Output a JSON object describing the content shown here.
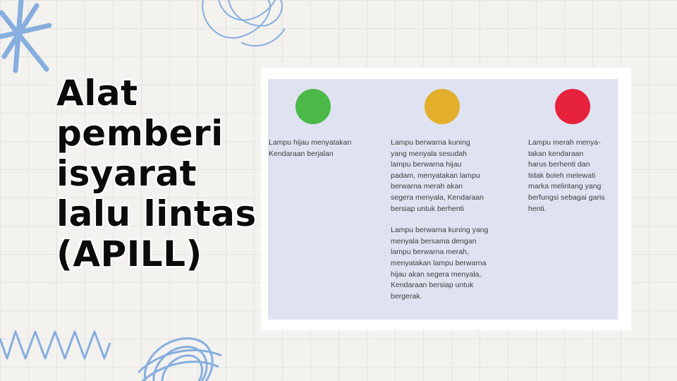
{
  "title": {
    "lines": [
      "Alat",
      "pemberi",
      "isyarat",
      "lalu lintas",
      "(APILL)"
    ]
  },
  "lights": [
    {
      "color_name": "green",
      "color": "#4cb848",
      "paragraphs": [
        "Lampu hijau menyatakan\nKendaraan berjalan"
      ]
    },
    {
      "color_name": "yellow",
      "color": "#e2ae2c",
      "paragraphs": [
        "Lampu berwarna kuning\nyang menyala sesudah\nlampu berwarna hijau\npadam, menyatakan lampu\nberwarna merah akan\nsegera menyala, Kendaraan\nbersiap untuk berhenti",
        "Lampu berwarna kuning yang\nmenyala bersama dengan\nlampu berwarna merah,\nmenyatakan lampu berwarna\nhijau akan segera menyala,\nKendaraan bersiap untuk\nbergerak."
      ]
    },
    {
      "color_name": "red",
      "color": "#e7223c",
      "paragraphs": [
        "Lampu merah menya-\ntakan kendaraan\nharus berhenti dan\ntidak boleh melewati\nmarka melintang yang\nberfungsi sebagai garis\nhenti."
      ]
    }
  ],
  "decoration": {
    "accent_color": "#86aede",
    "icons": [
      "star-doodle-icon",
      "loop-scribble-icon",
      "zigzag-icon",
      "ball-scribble-icon"
    ]
  }
}
